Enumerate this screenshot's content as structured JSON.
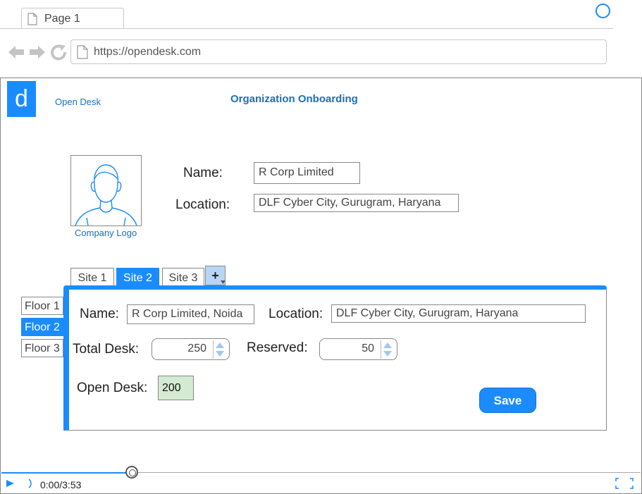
{
  "browser": {
    "tab_title": "Page 1",
    "url": "https://opendesk.com"
  },
  "header": {
    "logo_letter": "d",
    "brand_name": "Open Desk",
    "page_title": "Organization Onboarding"
  },
  "organization": {
    "logo_caption": "Company Logo",
    "name_label": "Name:",
    "name_value": "R Corp Limited",
    "location_label": "Location:",
    "location_value": "DLF Cyber City, Gurugram, Haryana"
  },
  "site_tabs": {
    "items": [
      "Site 1",
      "Site 2",
      "Site 3"
    ],
    "active_index": 1,
    "add_label": "+"
  },
  "floors": {
    "items": [
      "Floor 1",
      "Floor 2",
      "Floor 3"
    ],
    "active_index": 1
  },
  "site_form": {
    "name_label": "Name:",
    "name_value": "R Corp Limited, Noida",
    "location_label": "Location:",
    "location_value": "DLF Cyber City, Gurugram, Haryana",
    "total_desk_label": "Total Desk:",
    "total_desk_value": "250",
    "reserved_label": "Reserved:",
    "reserved_value": "50",
    "open_desk_label": "Open Desk:",
    "open_desk_value": "200",
    "save_label": "Save"
  },
  "media": {
    "time": "0:00/3:53"
  },
  "colors": {
    "accent": "#1a8cff",
    "brand_text": "#1a6fbf",
    "open_desk_bg": "#d5ead3"
  }
}
